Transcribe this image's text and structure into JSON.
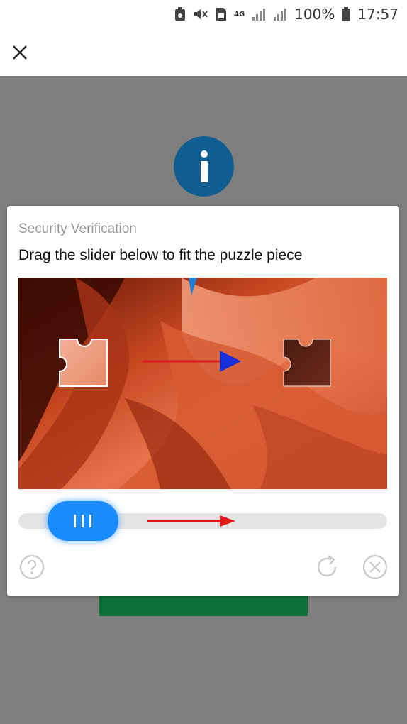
{
  "status_bar": {
    "network": "4G",
    "battery_percent": "100%",
    "time": "17:57",
    "icons": [
      "app-notification-icon",
      "mute-icon",
      "sim-icon",
      "signal-icon",
      "signal-icon",
      "battery-icon"
    ]
  },
  "header": {
    "close_icon": "close-icon"
  },
  "background": {
    "info_icon": "info-icon",
    "accent_color": "#0f5d91",
    "button_color": "#0d6f3a"
  },
  "modal": {
    "title": "Security Verification",
    "instruction": "Drag the slider below to fit the puzzle piece",
    "slider": {
      "handle_icon": "drag-grip-icon",
      "handle_color": "#1a8cff",
      "position": 0.12
    },
    "footer": {
      "help_icon": "help-icon",
      "refresh_icon": "refresh-icon",
      "close_icon": "close-circle-icon"
    }
  }
}
